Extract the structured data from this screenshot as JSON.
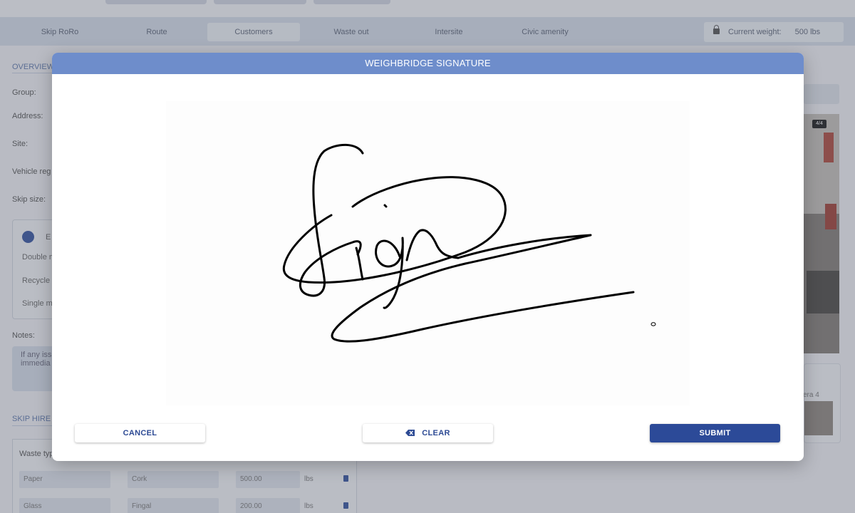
{
  "nav": {
    "items": [
      "Skip RoRo",
      "Route",
      "Customers",
      "Waste out",
      "Intersite",
      "Civic amenity"
    ],
    "active_index": 2,
    "weight_label": "Current weight:",
    "weight_value": "500 lbs"
  },
  "background": {
    "overview_title": "OVERVIEW",
    "labels": {
      "group": "Group:",
      "address": "Address:",
      "site": "Site:",
      "vehicle": "Vehicle reg",
      "skip_size": "Skip size:"
    },
    "card": {
      "head": "E",
      "lines": [
        "Double m",
        "Recycle",
        "Single m"
      ]
    },
    "notes_label": "Notes:",
    "notes_text": "If any iss\nimmedia",
    "skip_hire_title": "SKIP HIRE C",
    "table": {
      "header": "Waste typ",
      "rows": [
        {
          "waste": "Paper",
          "sub": "Cork",
          "amount": "500.00",
          "unit": "lbs"
        },
        {
          "waste": "Glass",
          "sub": "Fingal",
          "amount": "200.00",
          "unit": "lbs"
        }
      ]
    },
    "right": {
      "photo_badge": "4/4",
      "thumb_label": "era 4"
    }
  },
  "modal": {
    "title": "WEIGHBRIDGE SIGNATURE",
    "cancel_label": "CANCEL",
    "clear_label": "CLEAR",
    "submit_label": "SUBMIT",
    "clear_icon": "backspace-icon"
  },
  "colors": {
    "header": "#6e8dcb",
    "primary": "#2c4a98",
    "ink": "#000000"
  }
}
